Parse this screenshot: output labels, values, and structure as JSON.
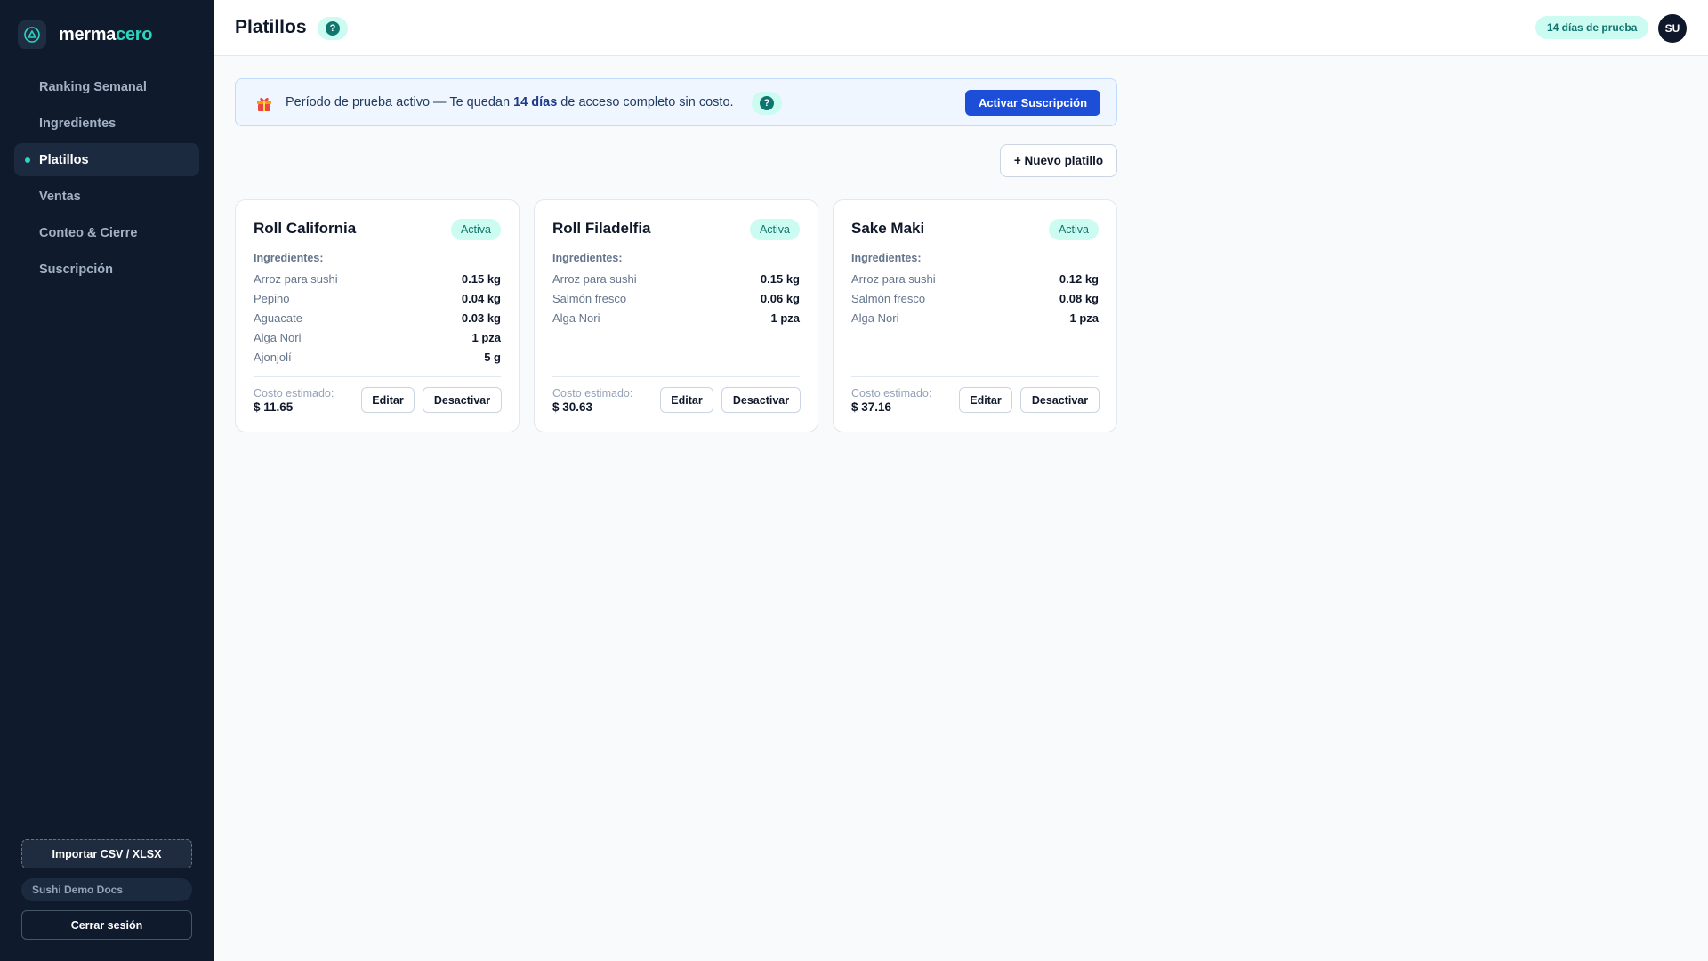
{
  "brand": {
    "name_part1": "merma",
    "name_part2": "cero"
  },
  "sidebar": {
    "items": [
      {
        "label": "Ranking Semanal",
        "active": false
      },
      {
        "label": "Ingredientes",
        "active": false
      },
      {
        "label": "Platillos",
        "active": true
      },
      {
        "label": "Ventas",
        "active": false
      },
      {
        "label": "Conteo & Cierre",
        "active": false
      },
      {
        "label": "Suscripción",
        "active": false
      }
    ],
    "import_label": "Importar CSV / XLSX",
    "org_label": "Sushi Demo Docs",
    "logout_label": "Cerrar sesión"
  },
  "header": {
    "title": "Platillos",
    "help_icon": "question-icon",
    "trial_badge": "14 días de prueba",
    "avatar_initials": "SU"
  },
  "banner": {
    "icon": "gift-icon",
    "text_before": "Período de prueba activo — Te quedan ",
    "text_bold": "14 días",
    "text_after": " de acceso completo sin costo.",
    "button_label": "Activar Suscripción"
  },
  "actions": {
    "new_dish_label": "+ Nuevo platillo"
  },
  "cards": [
    {
      "title": "Roll California",
      "status": "Activa",
      "ingredients_label": "Ingredientes:",
      "ingredients": [
        {
          "name": "Arroz para sushi",
          "qty": "0.15 kg"
        },
        {
          "name": "Pepino",
          "qty": "0.04 kg"
        },
        {
          "name": "Aguacate",
          "qty": "0.03 kg"
        },
        {
          "name": "Alga Nori",
          "qty": "1 pza"
        },
        {
          "name": "Ajonjolí",
          "qty": "5 g"
        }
      ],
      "cost_label": "Costo estimado:",
      "cost_value": "$ 11.65",
      "edit_label": "Editar",
      "deactivate_label": "Desactivar"
    },
    {
      "title": "Roll Filadelfia",
      "status": "Activa",
      "ingredients_label": "Ingredientes:",
      "ingredients": [
        {
          "name": "Arroz para sushi",
          "qty": "0.15 kg"
        },
        {
          "name": "Salmón fresco",
          "qty": "0.06 kg"
        },
        {
          "name": "Alga Nori",
          "qty": "1 pza"
        }
      ],
      "cost_label": "Costo estimado:",
      "cost_value": "$ 30.63",
      "edit_label": "Editar",
      "deactivate_label": "Desactivar"
    },
    {
      "title": "Sake Maki",
      "status": "Activa",
      "ingredients_label": "Ingredientes:",
      "ingredients": [
        {
          "name": "Arroz para sushi",
          "qty": "0.12 kg"
        },
        {
          "name": "Salmón fresco",
          "qty": "0.08 kg"
        },
        {
          "name": "Alga Nori",
          "qty": "1 pza"
        }
      ],
      "cost_label": "Costo estimado:",
      "cost_value": "$ 37.16",
      "edit_label": "Editar",
      "deactivate_label": "Desactivar"
    }
  ],
  "colors": {
    "sidebar_bg": "#0f1a2c",
    "accent_teal": "#2dd4bf",
    "primary_blue": "#1d4ed8",
    "badge_bg": "#ccfbf1",
    "badge_text": "#0f766e"
  }
}
